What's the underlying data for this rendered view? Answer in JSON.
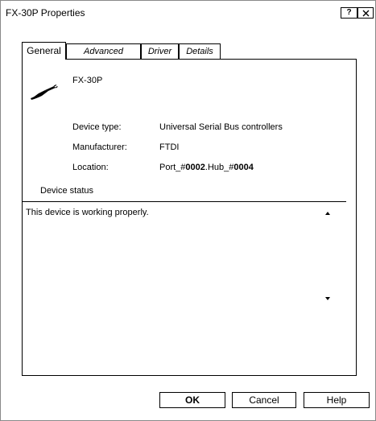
{
  "window": {
    "title": "FX-30P Properties",
    "help_glyph": "?",
    "close_icon": "close-icon"
  },
  "tabs": [
    {
      "label": "General",
      "selected": true
    },
    {
      "label": "Advanced",
      "selected": false
    },
    {
      "label": "Driver",
      "selected": false
    },
    {
      "label": "Details",
      "selected": false
    }
  ],
  "device": {
    "name": "FX-30P",
    "icon": "usb-cable-icon",
    "properties": [
      {
        "label": "Device type:",
        "value": "Universal Serial Bus controllers"
      },
      {
        "label": "Manufacturer:",
        "value": "FTDI"
      },
      {
        "label": "Location:",
        "value_prefix": "Port_#",
        "value_port": "0002",
        "value_mid": ".Hub_#",
        "value_hub": "0004"
      }
    ]
  },
  "status": {
    "heading": "Device status",
    "text": "This device is working properly."
  },
  "buttons": {
    "ok": "OK",
    "cancel": "Cancel",
    "help": "Help"
  }
}
